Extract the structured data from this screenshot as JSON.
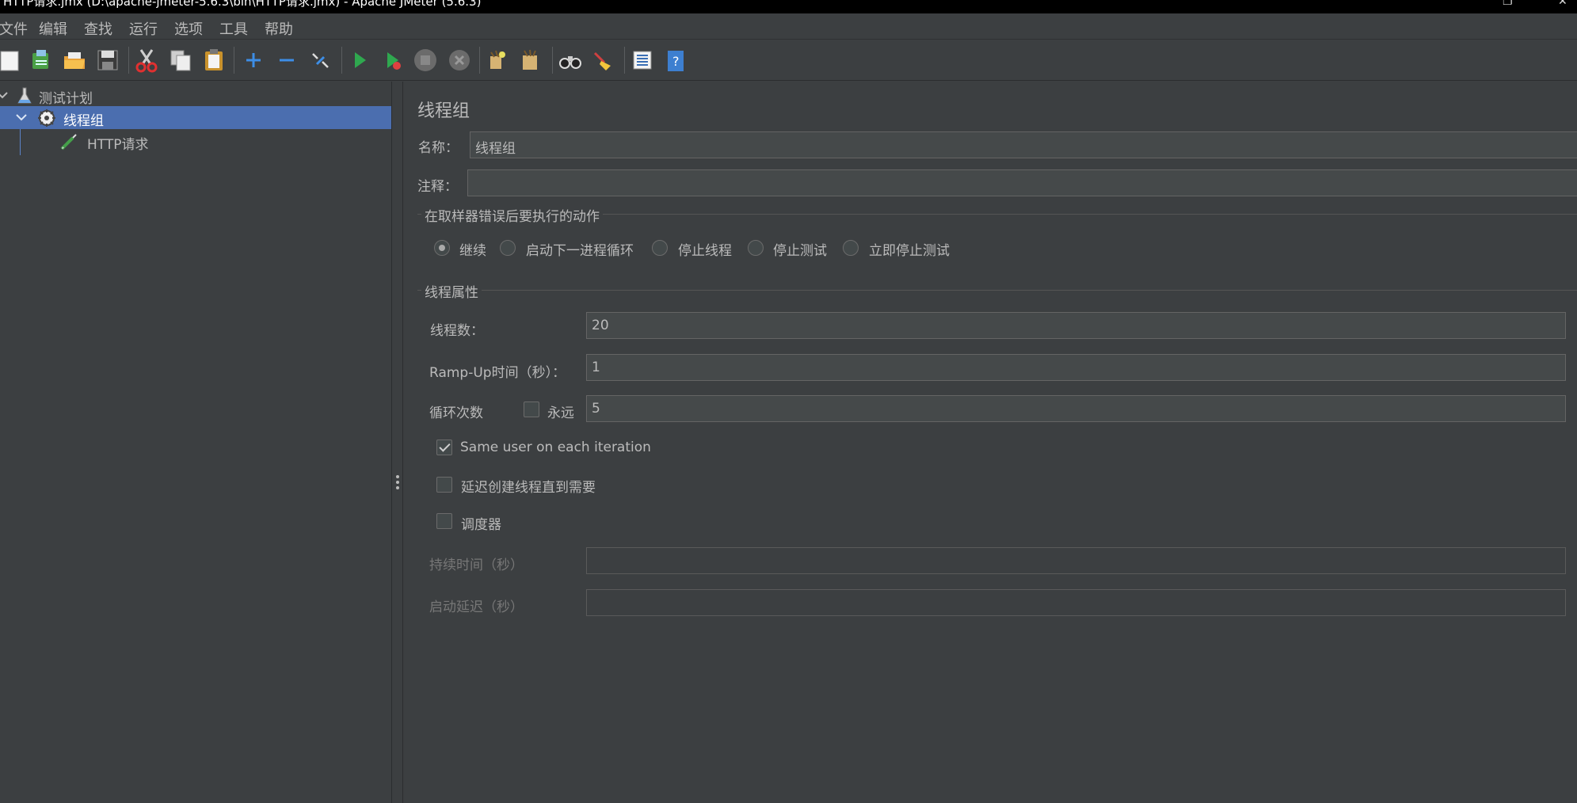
{
  "window": {
    "title": "HTTP请求.jmx (D:\\apache-jmeter-5.6.3\\bin\\HTTP请求.jmx) - Apache JMeter (5.6.3)"
  },
  "menu": [
    "文件",
    "编辑",
    "查找",
    "运行",
    "选项",
    "工具",
    "帮助"
  ],
  "toolbar": {
    "icons": [
      "new-icon",
      "templates-icon",
      "open-icon",
      "save-icon",
      "cut-icon",
      "copy-icon",
      "paste-icon",
      "expand-icon",
      "collapse-icon",
      "toggle-icon",
      "start-icon",
      "start-no-pause-icon",
      "stop-icon",
      "shutdown-icon",
      "clear-icon",
      "clear-all-icon",
      "search-icon",
      "reset-search-icon",
      "function-helper-icon",
      "help-icon"
    ]
  },
  "tree": {
    "items": [
      {
        "label": "测试计划",
        "level": 0,
        "icon": "test-plan-icon",
        "expanded": true
      },
      {
        "label": "线程组",
        "level": 1,
        "icon": "thread-group-icon",
        "expanded": true,
        "selected": true
      },
      {
        "label": "HTTP请求",
        "level": 2,
        "icon": "sampler-icon"
      }
    ]
  },
  "panel": {
    "title": "线程组",
    "name_label": "名称：",
    "name_value": "线程组",
    "comment_label": "注释：",
    "comment_value": "",
    "error_action": {
      "legend": "在取样器错误后要执行的动作",
      "options": [
        "继续",
        "启动下一进程循环",
        "停止线程",
        "停止测试",
        "立即停止测试"
      ],
      "selected": "继续"
    },
    "thread_props": {
      "legend": "线程属性",
      "threads_label": "线程数：",
      "threads_value": "20",
      "rampup_label": "Ramp-Up时间（秒）：",
      "rampup_value": "1",
      "loop_label": "循环次数",
      "forever_label": "永远",
      "forever_checked": false,
      "loop_value": "5",
      "same_user_label": "Same user on each iteration",
      "same_user_checked": true,
      "delay_label": "延迟创建线程直到需要",
      "delay_checked": false,
      "scheduler_label": "调度器",
      "scheduler_checked": false,
      "duration_label": "持续时间（秒）",
      "duration_value": "",
      "startup_delay_label": "启动延迟（秒）",
      "startup_delay_value": ""
    }
  }
}
